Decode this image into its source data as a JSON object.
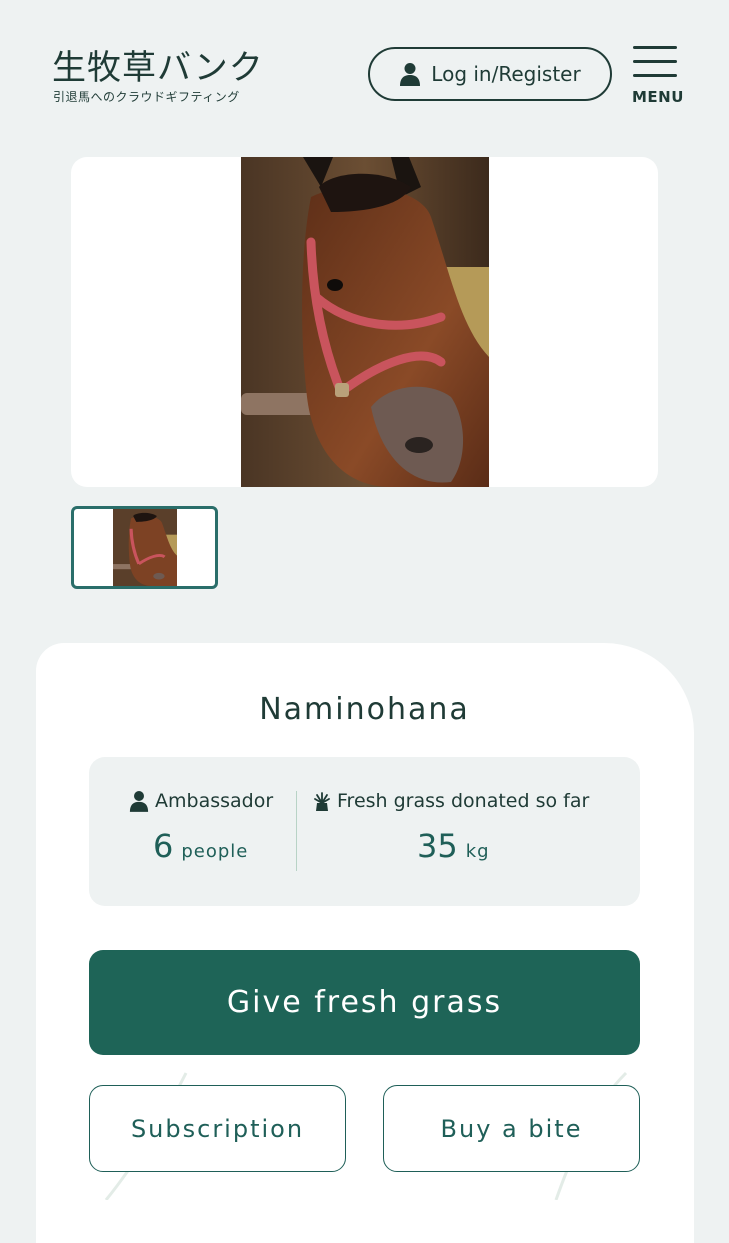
{
  "header": {
    "logo_title": "生牧草バンク",
    "logo_subtitle": "引退馬へのクラウドギフティング",
    "login_label": "Log in/Register",
    "menu_label": "MENU"
  },
  "horse": {
    "name": "Naminohana"
  },
  "stats": {
    "ambassador_label": "Ambassador",
    "ambassador_value": "6",
    "ambassador_unit": "people",
    "grass_label": "Fresh grass donated so far",
    "grass_value": "35",
    "grass_unit": "kg"
  },
  "actions": {
    "give_label": "Give fresh grass",
    "subscription_label": "Subscription",
    "bite_label": "Buy a bite"
  },
  "colors": {
    "background": "#eef2f2",
    "primary_text": "#1f3b36",
    "accent": "#1e6457",
    "thumb_border": "#2a6e6a"
  },
  "icons": {
    "login": "user-icon",
    "menu": "hamburger-menu-icon",
    "ambassador": "user-icon",
    "grass": "grass-icon"
  }
}
